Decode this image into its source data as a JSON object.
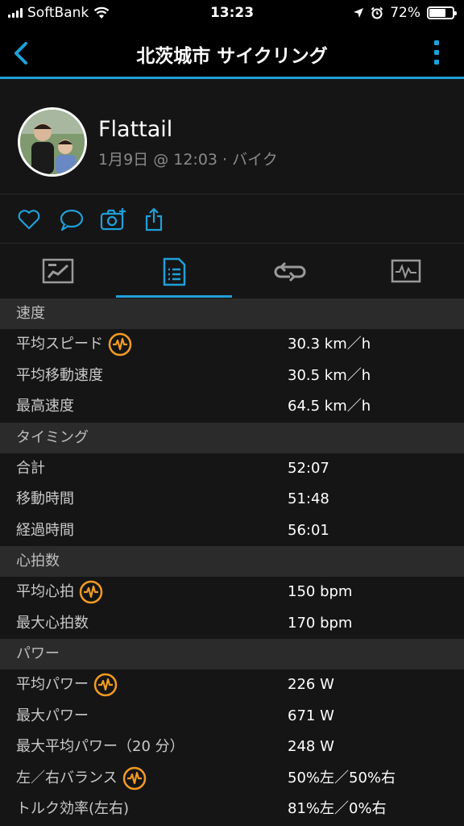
{
  "status_bar": {
    "carrier": "SoftBank",
    "time": "13:23",
    "battery": "72%",
    "battery_level": 0.72
  },
  "nav": {
    "title": "北茨城市 サイクリング"
  },
  "profile": {
    "name": "Flattail",
    "meta": "1月9日 @ 12:03 · バイク"
  },
  "colors": {
    "accent": "#1fa0d8",
    "badge": "#f29b21",
    "section_bg": "#2b2b2b",
    "row_bg": "#151515"
  },
  "sections": [
    {
      "title": "速度",
      "rows": [
        {
          "label": "平均スピード",
          "value": "30.3 km／h",
          "badge": true
        },
        {
          "label": "平均移動速度",
          "value": "30.5 km／h",
          "badge": false
        },
        {
          "label": "最高速度",
          "value": "64.5 km／h",
          "badge": false
        }
      ]
    },
    {
      "title": "タイミング",
      "rows": [
        {
          "label": "合計",
          "value": "52:07",
          "badge": false
        },
        {
          "label": "移動時間",
          "value": "51:48",
          "badge": false
        },
        {
          "label": "経過時間",
          "value": "56:01",
          "badge": false
        }
      ]
    },
    {
      "title": "心拍数",
      "rows": [
        {
          "label": "平均心拍",
          "value": "150 bpm",
          "badge": true
        },
        {
          "label": "最大心拍数",
          "value": "170 bpm",
          "badge": false
        }
      ]
    },
    {
      "title": "パワー",
      "rows": [
        {
          "label": "平均パワー",
          "value": "226 W",
          "badge": true
        },
        {
          "label": "最大パワー",
          "value": "671 W",
          "badge": false
        },
        {
          "label": "最大平均パワー（20 分）",
          "value": "248 W",
          "badge": false
        },
        {
          "label": "左／右バランス",
          "value": "50%左／50%右",
          "badge": true
        },
        {
          "label": "トルク効率(左右)",
          "value": "81%左／0%右",
          "badge": false
        }
      ]
    }
  ]
}
